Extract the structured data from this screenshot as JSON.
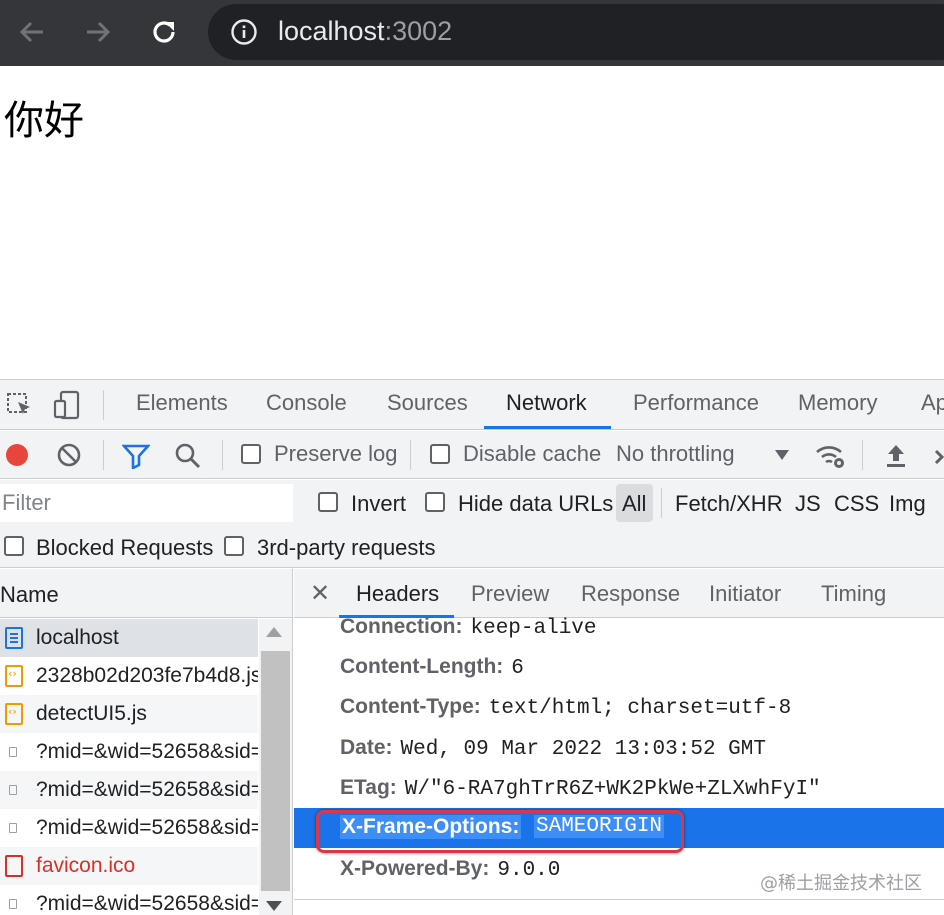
{
  "browser": {
    "url_host": "localhost",
    "url_port": ":3002",
    "back_icon": "arrow-left-icon",
    "forward_icon": "arrow-right-icon",
    "reload_icon": "reload-icon",
    "info_icon": "info-icon"
  },
  "page": {
    "text": "你好"
  },
  "devtools": {
    "tabs": [
      "Elements",
      "Console",
      "Sources",
      "Network",
      "Performance",
      "Memory",
      "Ap"
    ],
    "active_tab": "Network",
    "toolbar": {
      "preserve_log": "Preserve log",
      "disable_cache": "Disable cache",
      "throttling": "No throttling"
    },
    "filter": {
      "placeholder": "Filter",
      "invert": "Invert",
      "hide_data_urls": "Hide data URLs",
      "all": "All",
      "types": [
        "Fetch/XHR",
        "JS",
        "CSS",
        "Img"
      ]
    },
    "blocked_requests": "Blocked Requests",
    "third_party": "3rd-party requests",
    "request_list": {
      "header": "Name",
      "rows": [
        {
          "name": "localhost",
          "type": "doc"
        },
        {
          "name": "2328b02d203fe7b4d8.js",
          "type": "js"
        },
        {
          "name": "detectUI5.js",
          "type": "js"
        },
        {
          "name": "?mid=&wid=52658&sid=",
          "type": "other"
        },
        {
          "name": "?mid=&wid=52658&sid=",
          "type": "other"
        },
        {
          "name": "?mid=&wid=52658&sid=",
          "type": "other"
        },
        {
          "name": "favicon.ico",
          "type": "err"
        },
        {
          "name": "?mid=&wid=52658&sid=",
          "type": "other"
        }
      ]
    },
    "details": {
      "tabs": [
        "Headers",
        "Preview",
        "Response",
        "Initiator",
        "Timing"
      ],
      "active_tab": "Headers",
      "headers": [
        {
          "key": "Connection:",
          "value": "keep-alive"
        },
        {
          "key": "Content-Length:",
          "value": "6"
        },
        {
          "key": "Content-Type:",
          "value": "text/html; charset=utf-8"
        },
        {
          "key": "Date:",
          "value": "Wed, 09 Mar 2022 13:03:52 GMT"
        },
        {
          "key": "ETag:",
          "value": "W/\"6-RA7ghTrR6Z+WK2PkWe+ZLXwhFyI\""
        },
        {
          "key": "X-Frame-Options:",
          "value": "SAMEORIGIN"
        },
        {
          "key": "X-Powered-By:",
          "value": "9.0.0"
        }
      ]
    }
  },
  "watermark": "@稀土掘金技术社区",
  "colors": {
    "accent": "#1a73e8",
    "record": "#e8453c",
    "highlight_border": "#d93848",
    "error_text": "#d93025"
  }
}
